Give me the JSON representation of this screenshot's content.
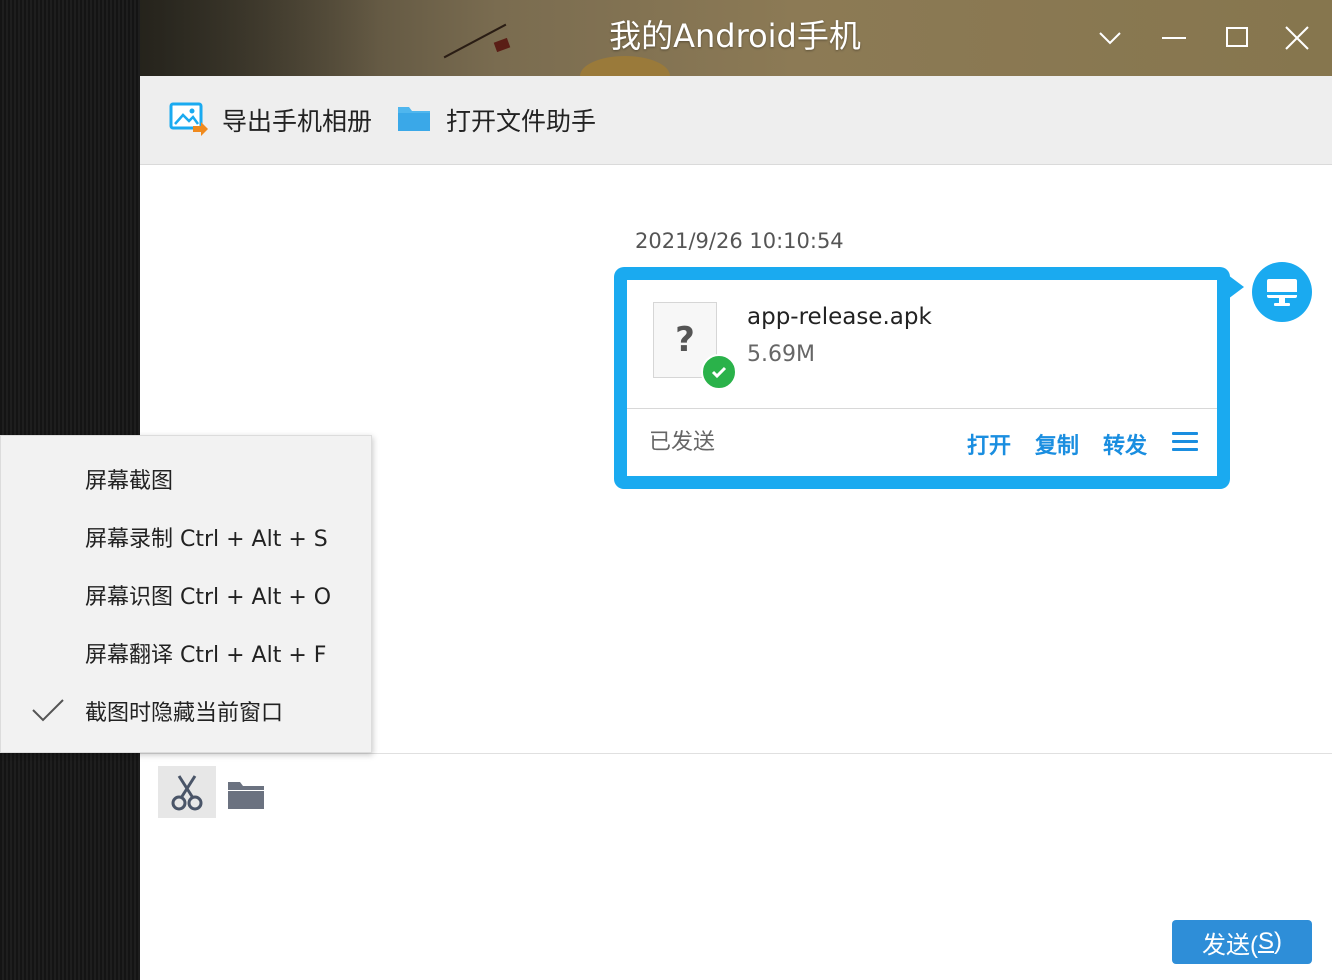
{
  "window": {
    "title": "我的Android手机"
  },
  "toolbar": {
    "export_album_label": "导出手机相册",
    "open_file_helper_label": "打开文件助手"
  },
  "message": {
    "timestamp": "2021/9/26 10:10:54",
    "file_name": "app-release.apk",
    "file_size": "5.69M",
    "file_icon_glyph": "?",
    "status": "已发送",
    "actions": {
      "open": "打开",
      "copy": "复制",
      "forward": "转发"
    }
  },
  "context_menu": {
    "items": [
      {
        "label": "屏幕截图",
        "checked": false
      },
      {
        "label": "屏幕录制 Ctrl + Alt + S",
        "checked": false
      },
      {
        "label": "屏幕识图 Ctrl + Alt + O",
        "checked": false
      },
      {
        "label": "屏幕翻译 Ctrl + Alt + F",
        "checked": false
      },
      {
        "label": "截图时隐藏当前窗口",
        "checked": true
      }
    ]
  },
  "send": {
    "label": "发送(",
    "hotkey": "S",
    "label_end": ")"
  },
  "colors": {
    "accent": "#1aaaf0",
    "link": "#1a8ee0",
    "send_button": "#2e8ed8",
    "success": "#2ab24a"
  },
  "icons": {
    "export_album": "image-export-icon",
    "open_file_helper": "folder-icon",
    "window_controls": [
      "chevron-down-icon",
      "minimize-icon",
      "maximize-icon",
      "close-icon"
    ],
    "avatar": "desktop-monitor-icon",
    "tools": [
      "scissors-icon",
      "folder-icon"
    ],
    "menu": "hamburger-menu-icon"
  }
}
